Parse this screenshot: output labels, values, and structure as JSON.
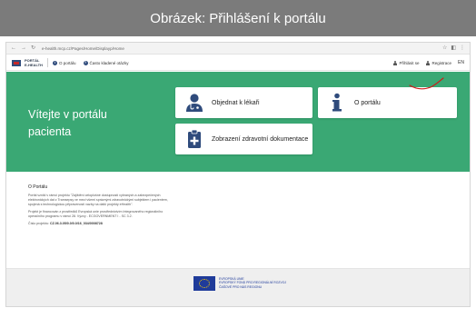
{
  "caption": "Obrázek: Přihlášení k portálu",
  "browser": {
    "url": "e-health.mcp.cz/Pages/Home/Displayp/Home",
    "back_icon": "arrow-left-icon",
    "forward_icon": "arrow-right-icon",
    "reload_icon": "reload-icon"
  },
  "header": {
    "brand_line1": "PORTÁL",
    "brand_line2": "E-HEALTH",
    "menu": [
      {
        "label": "O portálu",
        "icon": "info-icon"
      },
      {
        "label": "Často kladené otázky",
        "icon": "question-icon"
      }
    ],
    "login_label": "Přihlásit se",
    "register_label": "Registrace",
    "lang_label": "EN"
  },
  "hero": {
    "title_line1": "Vítejte v portálu",
    "title_line2": "pacienta",
    "tiles": [
      {
        "label": "Objednat k lékaři",
        "icon": "doctor-icon"
      },
      {
        "label": "O portálu",
        "icon": "info-icon"
      },
      {
        "label": "Zobrazení zdravotní dokumentace",
        "icon": "medical-clipboard-icon"
      }
    ]
  },
  "about": {
    "heading": "O Portálu",
    "p1": "Portál vznikl v rámci projektu \"Zajištění celoplošné dostupnosti vybraných a zabezpečených elektronických dat z Tramsepsy ve mezi všemi správnými zdravotnickými subjektem i pacientem, spojená s technologickou připraveností vazby na další projekty eHealth\".",
    "p2": "Projekt je financován z prostředků Evropská unie prostřednictvím Integrovaného regionálního operačního programu v rámci 28. Výzvy - ECGOVERNMENT I - SC 3.2.",
    "reg_label": "Číslo projektu:",
    "reg_value": "CZ.06.3.05/0.0/0.0/16_034/0008728"
  },
  "footer": {
    "eu_line1": "EVROPSKÁ UNIE",
    "eu_line2": "EVROPSKÝ FOND PRO REGIONÁLNÍ ROZVOJ",
    "eu_line3": "ČAŠOVÉ PRO NÁS REGIONU"
  },
  "colors": {
    "hero_green": "#3aa874",
    "caption_gray": "#7b7b7b",
    "icon_navy": "#2f4b7c",
    "annotation_red": "#d01818",
    "eu_blue": "#1f3b9a"
  }
}
